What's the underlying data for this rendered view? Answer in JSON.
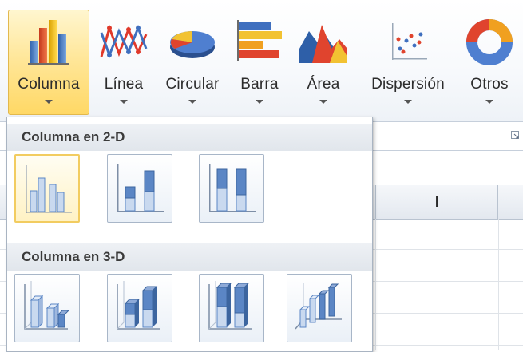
{
  "ribbon": {
    "buttons": [
      {
        "label": "Columna",
        "icon": "column-chart-icon",
        "active": true
      },
      {
        "label": "Línea",
        "icon": "line-chart-icon"
      },
      {
        "label": "Circular",
        "icon": "pie-chart-icon"
      },
      {
        "label": "Barra",
        "icon": "bar-chart-icon"
      },
      {
        "label": "Área",
        "icon": "area-chart-icon"
      },
      {
        "label": "Dispersión",
        "icon": "scatter-chart-icon"
      },
      {
        "label": "Otros",
        "icon": "doughnut-chart-icon"
      }
    ],
    "launcher_icon": "dialog-launcher-icon"
  },
  "sheet": {
    "column_header": "I"
  },
  "gallery": {
    "sections": [
      {
        "title": "Columna en 2-D",
        "items": [
          {
            "icon": "clustered-column-icon",
            "hover": true
          },
          {
            "icon": "stacked-column-icon"
          },
          {
            "icon": "100-stacked-column-icon"
          }
        ]
      },
      {
        "title": "Columna en 3-D",
        "items": [
          {
            "icon": "3d-clustered-column-icon"
          },
          {
            "icon": "3d-stacked-column-icon"
          },
          {
            "icon": "3d-100-stacked-column-icon"
          },
          {
            "icon": "3d-column-icon"
          }
        ]
      }
    ]
  },
  "colors": {
    "active_button_bg": "#ffe79b",
    "active_button_border": "#e2b84d",
    "column_blue": "#5b86c5",
    "column_light": "#c9d9ef"
  }
}
